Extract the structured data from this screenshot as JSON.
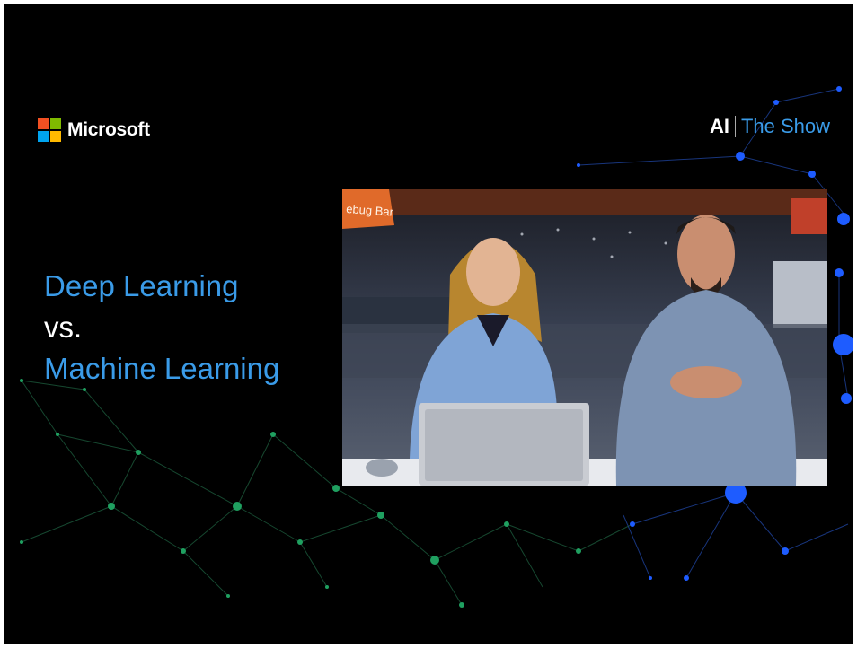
{
  "brand": {
    "logo_text": "Microsoft",
    "logo_colors": [
      "#f25022",
      "#7fba00",
      "#00a4ef",
      "#ffb900"
    ]
  },
  "show": {
    "prefix": "AI",
    "name": "The Show"
  },
  "headline": {
    "line1": "Deep Learning",
    "line2": "vs.",
    "line3": "Machine Learning"
  },
  "video": {
    "sign_text": "ebug Bar",
    "description": "two presenters at a desk in a conference hall"
  },
  "colors": {
    "accent_blue": "#3a9be8",
    "network_green": "#1fa060",
    "network_blue": "#1e5cff",
    "background": "#000000"
  }
}
